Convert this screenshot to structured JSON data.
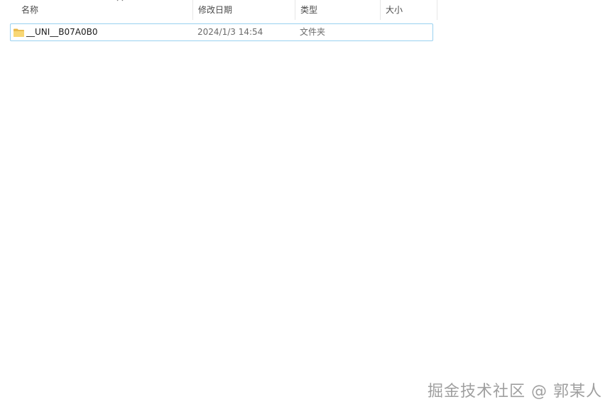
{
  "columns": {
    "name": "名称",
    "date": "修改日期",
    "type": "类型",
    "size": "大小"
  },
  "sort": {
    "column": "name",
    "direction": "ascending",
    "icon": "chevron-up-icon"
  },
  "files": [
    {
      "icon": "folder-icon",
      "name": "__UNI__B07A0B0",
      "date": "2024/1/3 14:54",
      "type": "文件夹",
      "size": ""
    }
  ],
  "watermark": "掘金技术社区 @ 郭某人",
  "colors": {
    "selection_border": "#99d1f0",
    "folder_yellow": "#f8d775",
    "folder_dark": "#e8b84a"
  }
}
